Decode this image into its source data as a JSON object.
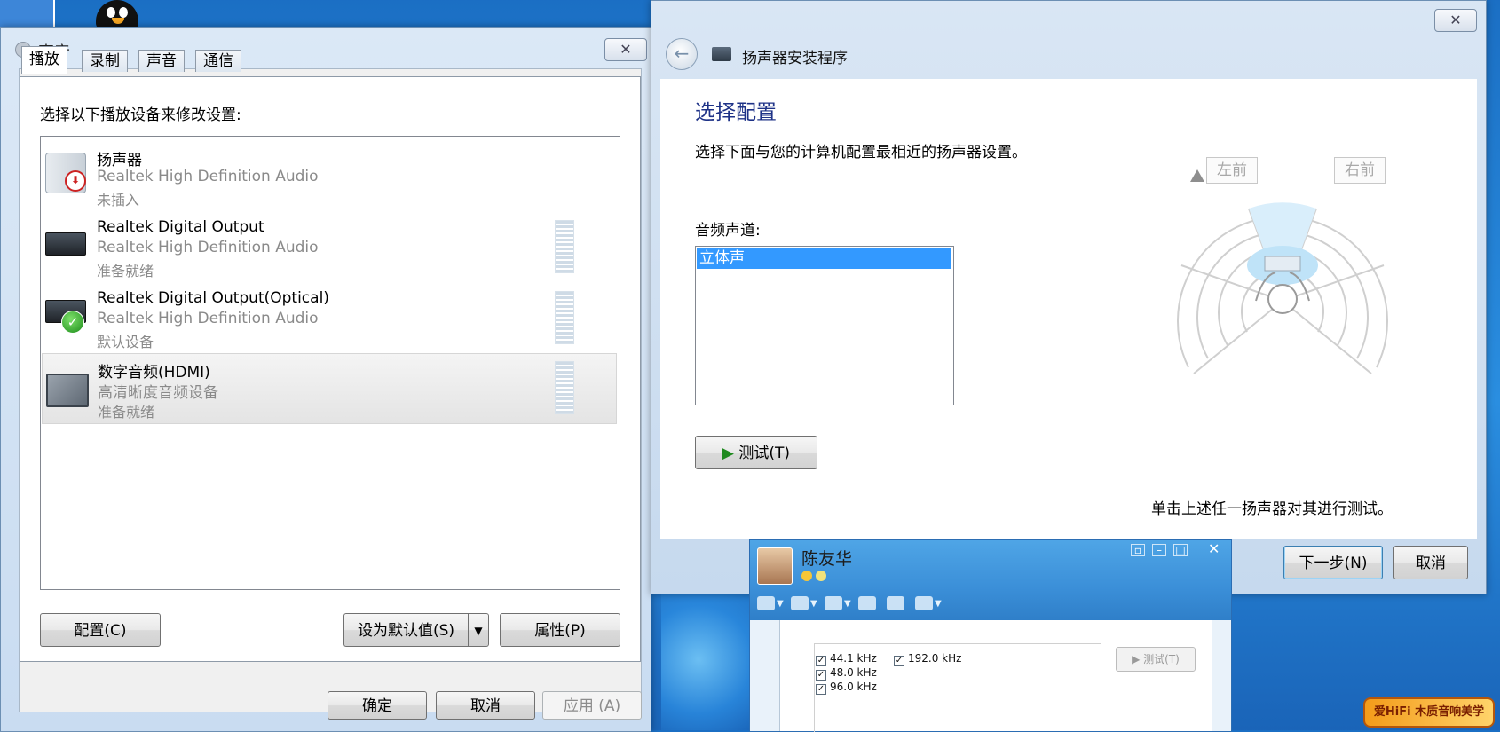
{
  "sound_dialog": {
    "title": "声音",
    "tabs": [
      {
        "label": "播放"
      },
      {
        "label": "录制"
      },
      {
        "label": "声音"
      },
      {
        "label": "通信"
      }
    ],
    "instruction": "选择以下播放设备来修改设置:",
    "devices": [
      {
        "name": "扬声器",
        "driver": "Realtek High Definition Audio",
        "status": "未插入"
      },
      {
        "name": "Realtek Digital Output",
        "driver": "Realtek High Definition Audio",
        "status": "准备就绪"
      },
      {
        "name": "Realtek Digital Output(Optical)",
        "driver": "Realtek High Definition Audio",
        "status": "默认设备"
      },
      {
        "name": "数字音频(HDMI)",
        "driver": "高清晰度音频设备",
        "status": "准备就绪"
      }
    ],
    "buttons": {
      "configure": "配置(C)",
      "set_default": "设为默认值(S)",
      "properties": "属性(P)",
      "ok": "确定",
      "cancel": "取消",
      "apply": "应用 (A)"
    }
  },
  "speaker_wizard": {
    "title": "扬声器安装程序",
    "heading": "选择配置",
    "description": "选择下面与您的计算机配置最相近的扬声器设置。",
    "channel_label": "音频声道:",
    "channels": [
      "立体声"
    ],
    "selected_channel": "立体声",
    "test_button": "测试(T)",
    "diagram": {
      "front_left": "左前",
      "front_right": "右前"
    },
    "hint": "单击上述任一扬声器对其进行测试。",
    "next_button": "下一步(N)",
    "cancel_button": "取消"
  },
  "qq_chat": {
    "contact_name": "陈友华",
    "sample_rates": [
      {
        "label": "44.1 kHz",
        "checked": true
      },
      {
        "label": "48.0 kHz",
        "checked": true
      },
      {
        "label": "96.0 kHz",
        "checked": true
      },
      {
        "label": "192.0 kHz",
        "checked": true
      }
    ],
    "test_button": "测试(T)"
  },
  "watermark": {
    "text": "爱HiFi 木质音响美学"
  }
}
